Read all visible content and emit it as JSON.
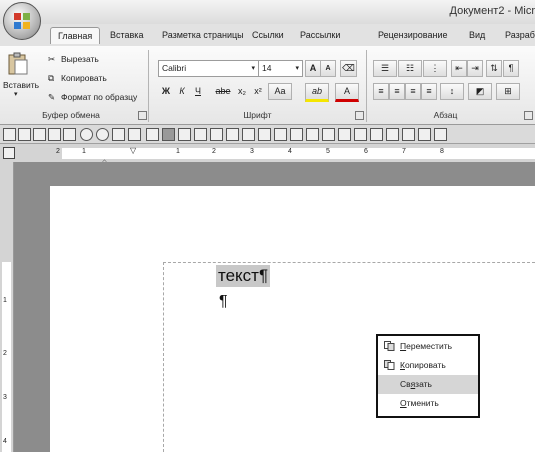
{
  "window": {
    "title": "Документ2 - Micr"
  },
  "tabs": [
    "Главная",
    "Вставка",
    "Разметка страницы",
    "Ссылки",
    "Рассылки",
    "Рецензирование",
    "Вид",
    "Разраб"
  ],
  "clipboard": {
    "paste": "Вставить",
    "cut": "Вырезать",
    "copy": "Копировать",
    "format_painter": "Формат по образцу",
    "group_label": "Буфер обмена"
  },
  "font": {
    "name": "Calibri",
    "size": "14",
    "grow": "A",
    "shrink": "A",
    "bold": "Ж",
    "italic": "К",
    "underline": "Ч",
    "strike": "abe",
    "subscript": "x₂",
    "superscript": "x²",
    "case": "Aa",
    "highlight": "ab",
    "color": "A",
    "group_label": "Шрифт"
  },
  "paragraph": {
    "group_label": "Абзац"
  },
  "ruler": {
    "marks": [
      "2",
      "1",
      "1",
      "2",
      "3",
      "4",
      "5",
      "6",
      "7",
      "8"
    ],
    "vmarks": [
      "1",
      "2",
      "3",
      "4"
    ]
  },
  "document": {
    "line1": "текст¶",
    "line2": "¶"
  },
  "context_menu": {
    "items": [
      {
        "label": "Переместить",
        "icon": "move-icon",
        "accel": "П"
      },
      {
        "label": "Копировать",
        "icon": "copy-icon",
        "accel": "К"
      },
      {
        "label": "Связать",
        "icon": "",
        "accel": "я",
        "highlighted": true
      },
      {
        "label": "Отменить",
        "icon": "",
        "accel": "О"
      }
    ]
  }
}
